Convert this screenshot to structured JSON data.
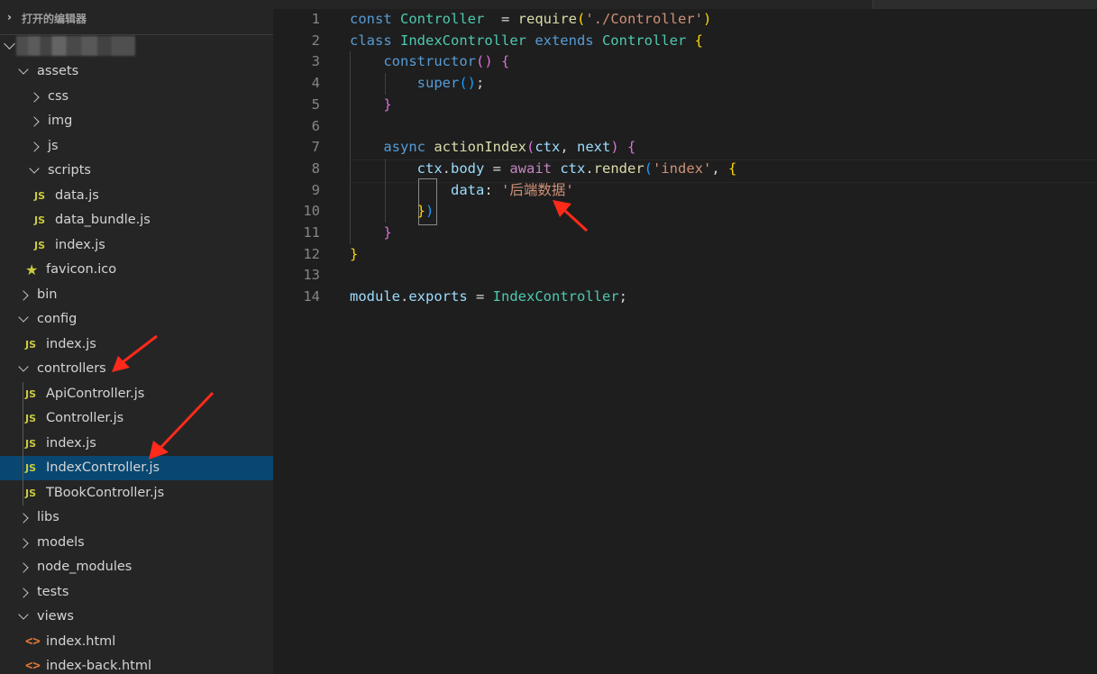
{
  "explorer": {
    "open_editors_label": "打开的编辑器",
    "tree": [
      {
        "label": "assets",
        "kind": "folder",
        "open": true,
        "depth": 1
      },
      {
        "label": "css",
        "kind": "folder",
        "open": false,
        "depth": 2
      },
      {
        "label": "img",
        "kind": "folder",
        "open": false,
        "depth": 2
      },
      {
        "label": "js",
        "kind": "folder",
        "open": false,
        "depth": 2
      },
      {
        "label": "scripts",
        "kind": "folder",
        "open": true,
        "depth": 2
      },
      {
        "label": "data.js",
        "kind": "js",
        "depth": 3
      },
      {
        "label": "data_bundle.js",
        "kind": "js",
        "depth": 3
      },
      {
        "label": "index.js",
        "kind": "js",
        "depth": 3
      },
      {
        "label": "favicon.ico",
        "kind": "star",
        "depth": 2
      },
      {
        "label": "bin",
        "kind": "folder",
        "open": false,
        "depth": 1
      },
      {
        "label": "config",
        "kind": "folder",
        "open": true,
        "depth": 1
      },
      {
        "label": "index.js",
        "kind": "js",
        "depth": 2
      },
      {
        "label": "controllers",
        "kind": "folder",
        "open": true,
        "depth": 1
      },
      {
        "label": "ApiController.js",
        "kind": "js",
        "depth": 2
      },
      {
        "label": "Controller.js",
        "kind": "js",
        "depth": 2
      },
      {
        "label": "index.js",
        "kind": "js",
        "depth": 2
      },
      {
        "label": "IndexController.js",
        "kind": "js",
        "depth": 2,
        "selected": true
      },
      {
        "label": "TBookController.js",
        "kind": "js",
        "depth": 2
      },
      {
        "label": "libs",
        "kind": "folder",
        "open": false,
        "depth": 1
      },
      {
        "label": "models",
        "kind": "folder",
        "open": false,
        "depth": 1
      },
      {
        "label": "node_modules",
        "kind": "folder",
        "open": false,
        "depth": 1
      },
      {
        "label": "tests",
        "kind": "folder",
        "open": false,
        "depth": 1
      },
      {
        "label": "views",
        "kind": "folder",
        "open": true,
        "depth": 1
      },
      {
        "label": "index.html",
        "kind": "html",
        "depth": 2
      },
      {
        "label": "index-back.html",
        "kind": "html",
        "depth": 2
      }
    ],
    "js_badge": "JS",
    "html_badge": "<>"
  },
  "editor": {
    "line_numbers": [
      "1",
      "2",
      "3",
      "4",
      "5",
      "6",
      "7",
      "8",
      "9",
      "10",
      "11",
      "12",
      "13",
      "14"
    ],
    "lines": [
      [
        [
          "kw",
          "const "
        ],
        [
          "cls",
          "Controller"
        ],
        [
          "",
          "  = "
        ],
        [
          "fn",
          "require"
        ],
        [
          "br1",
          "("
        ],
        [
          "str",
          "'./Controller'"
        ],
        [
          "br1",
          ")"
        ]
      ],
      [
        [
          "kw",
          "class "
        ],
        [
          "cls",
          "IndexController "
        ],
        [
          "kw",
          "extends "
        ],
        [
          "cls",
          "Controller "
        ],
        [
          "br1",
          "{"
        ]
      ],
      [
        [
          "",
          "    "
        ],
        [
          "kw",
          "constructor"
        ],
        [
          "br2",
          "() {"
        ]
      ],
      [
        [
          "",
          "        "
        ],
        [
          "kw",
          "super"
        ],
        [
          "br3",
          "()"
        ],
        [
          "",
          ";"
        ]
      ],
      [
        [
          "",
          "    "
        ],
        [
          "br2",
          "}"
        ]
      ],
      [],
      [
        [
          "",
          "    "
        ],
        [
          "kw",
          "async "
        ],
        [
          "fn",
          "actionIndex"
        ],
        [
          "br2",
          "("
        ],
        [
          "var",
          "ctx"
        ],
        [
          "",
          ", "
        ],
        [
          "var",
          "next"
        ],
        [
          "br2",
          ")"
        ],
        [
          "",
          ""
        ],
        [
          "br2",
          " {"
        ]
      ],
      [
        [
          "",
          "        "
        ],
        [
          "var",
          "ctx"
        ],
        [
          "",
          "."
        ],
        [
          "var",
          "body"
        ],
        [
          "",
          ""
        ],
        [
          "",
          " = "
        ],
        [
          "kw2",
          "await "
        ],
        [
          "var",
          "ctx"
        ],
        [
          "",
          "."
        ],
        [
          "fn",
          "render"
        ],
        [
          "br3",
          "("
        ],
        [
          "str",
          "'index'"
        ],
        [
          "",
          ", "
        ],
        [
          "br1",
          "{"
        ]
      ],
      [
        [
          "",
          "            "
        ],
        [
          "var",
          "data"
        ],
        [
          "",
          ": "
        ],
        [
          "str",
          "'后端数据'"
        ]
      ],
      [
        [
          "",
          "        "
        ],
        [
          "br1",
          "}"
        ],
        [
          "br3",
          ")"
        ]
      ],
      [
        [
          "",
          "    "
        ],
        [
          "br2",
          "}"
        ]
      ],
      [
        [
          "br1",
          "}"
        ]
      ],
      [],
      [
        [
          "var",
          "module"
        ],
        [
          "",
          "."
        ],
        [
          "var",
          "exports"
        ],
        [
          "",
          " = "
        ],
        [
          "cls",
          "IndexController"
        ],
        [
          "",
          ";"
        ]
      ]
    ]
  }
}
